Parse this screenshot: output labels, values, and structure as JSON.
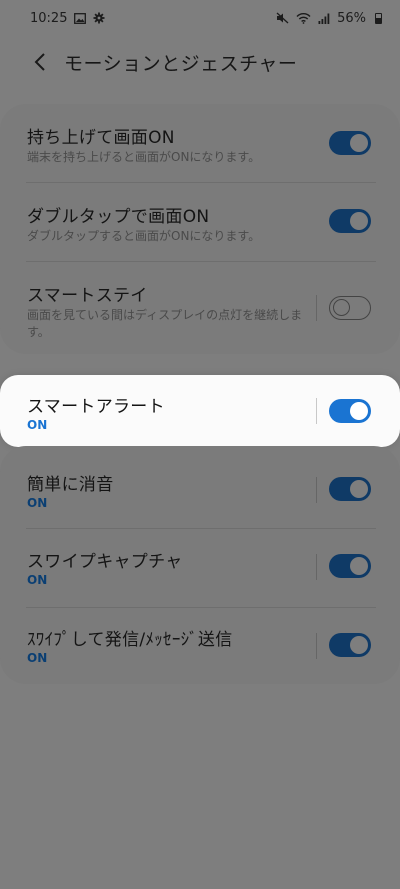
{
  "status_bar": {
    "time": "10:25",
    "battery": "56%",
    "icons": [
      "image-icon",
      "gear-icon",
      "mute-icon",
      "wifi-icon",
      "signal-icon",
      "battery-icon"
    ]
  },
  "header": {
    "back_icon": "chevron-left-icon",
    "title": "モーションとジェスチャー"
  },
  "settings": [
    {
      "title": "持ち上げて画面ON",
      "subtitle": "端末を持ち上げると画面がONになります。",
      "enabled": true
    },
    {
      "title": "ダブルタップで画面ON",
      "subtitle": "ダブルタップすると画面がONになります。",
      "enabled": true
    },
    {
      "title": "スマートステイ",
      "subtitle": "画面を見ている間はディスプレイの点灯を継続します。",
      "enabled": false
    },
    {
      "title": "スマートアラート",
      "status": "ON",
      "enabled": true,
      "highlighted": true
    },
    {
      "title": "簡単に消音",
      "status": "ON",
      "enabled": true
    },
    {
      "title": "スワイプキャプチャ",
      "status": "ON",
      "enabled": true
    },
    {
      "title": "ｽﾜｲﾌﾟして発信/ﾒｯｾｰｼﾞ送信",
      "status": "ON",
      "enabled": true
    }
  ],
  "colors": {
    "accent": "#1a74d2",
    "dim_overlay_bg": "#7e7e7e",
    "highlight_bg": "#fbfbfb"
  }
}
